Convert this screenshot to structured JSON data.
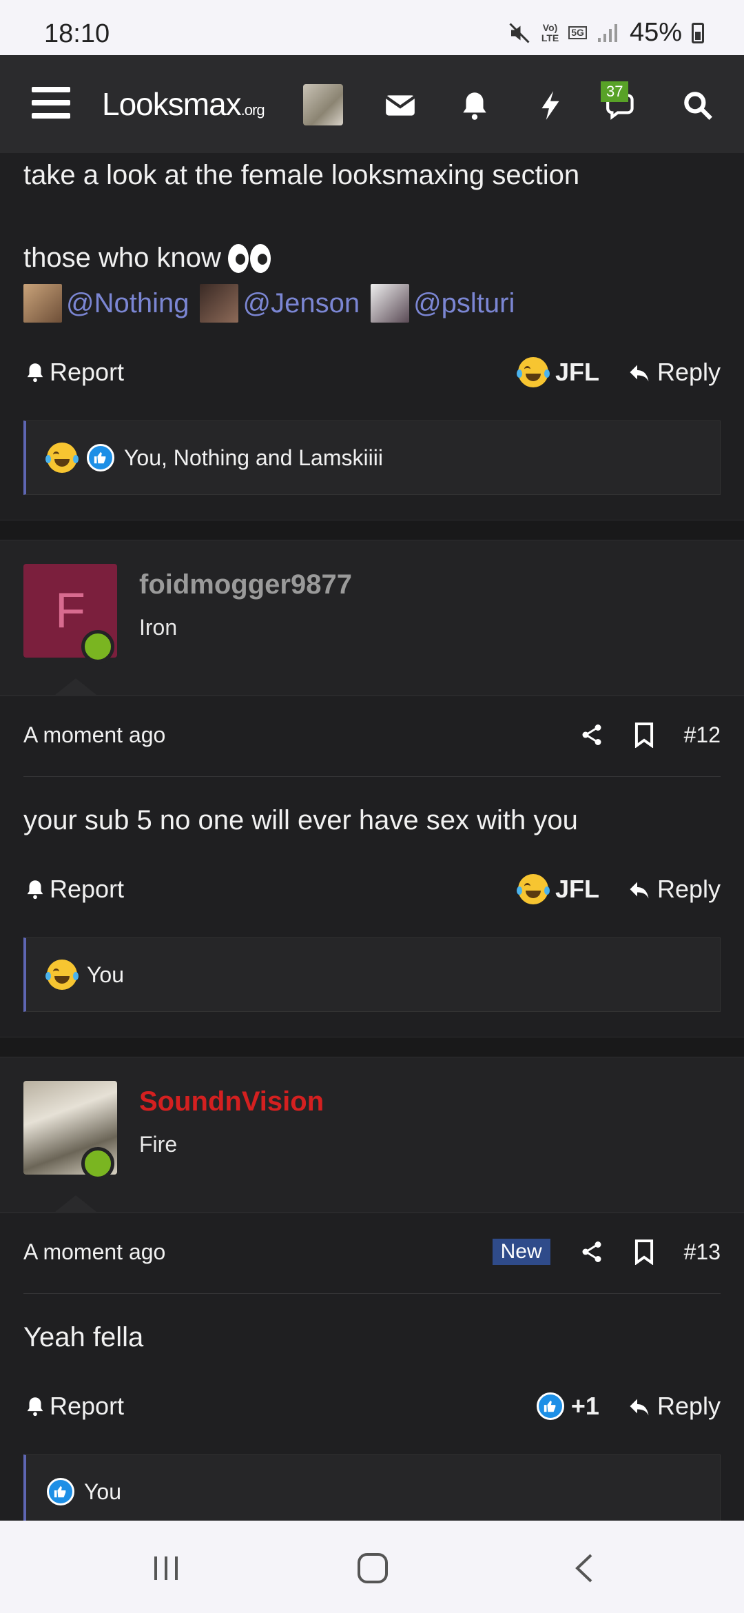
{
  "status": {
    "time": "18:10",
    "net_top": "Vo)",
    "net_bottom": "LTE",
    "fiveg": "5G",
    "battery": "45%"
  },
  "header": {
    "logo_main": "Looksmax",
    "logo_suffix": ".org",
    "notif_count": "37"
  },
  "post1": {
    "line1": "take a look at the female looksmaxing section",
    "line2": "those who know",
    "mentions": [
      "@Nothing",
      "@Jenson",
      "@pslturi"
    ],
    "report": "Report",
    "reaction": "JFL",
    "reply": "Reply",
    "reactors": "You, Nothing and Lamskiiii"
  },
  "post12": {
    "user_initial": "F",
    "username": "foidmogger9877",
    "user_title": "Iron",
    "time": "A moment ago",
    "number": "#12",
    "text": "your sub 5 no one will ever have sex with you",
    "report": "Report",
    "reaction": "JFL",
    "reply": "Reply",
    "reactors": "You"
  },
  "post13": {
    "username": "SoundnVision",
    "user_title": "Fire",
    "time": "A moment ago",
    "new_label": "New",
    "number": "#13",
    "text": "Yeah fella",
    "report": "Report",
    "reaction": "+1",
    "reply": "Reply",
    "reactors": "You"
  },
  "colors": {
    "accent": "#5e66b3",
    "online": "#7ab521",
    "username_red": "#d42020",
    "username_gray": "#9a9a9a",
    "new_badge": "#2f4b8a"
  }
}
